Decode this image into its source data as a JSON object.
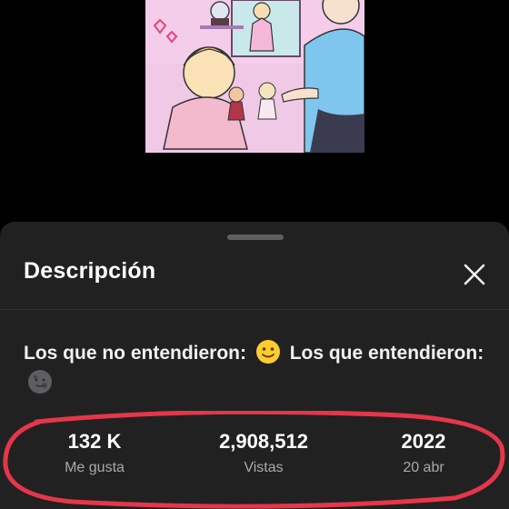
{
  "sheet": {
    "title": "Descripción",
    "description": {
      "part1": "Los que no entendieron:",
      "part2": "Los que entendieron:",
      "emoji1": "smiling-face-emoji",
      "emoji2": "new-moon-face-emoji"
    },
    "stats": [
      {
        "value": "132 K",
        "label": "Me gusta"
      },
      {
        "value": "2,908,512",
        "label": "Vistas"
      },
      {
        "value": "2022",
        "label": "20 abr"
      }
    ]
  },
  "icons": {
    "close": "close-icon"
  },
  "colors": {
    "background": "#000000",
    "sheet": "#212121",
    "highlight": "#e5364a",
    "thumbnail_bg": "#f6d6ef"
  }
}
